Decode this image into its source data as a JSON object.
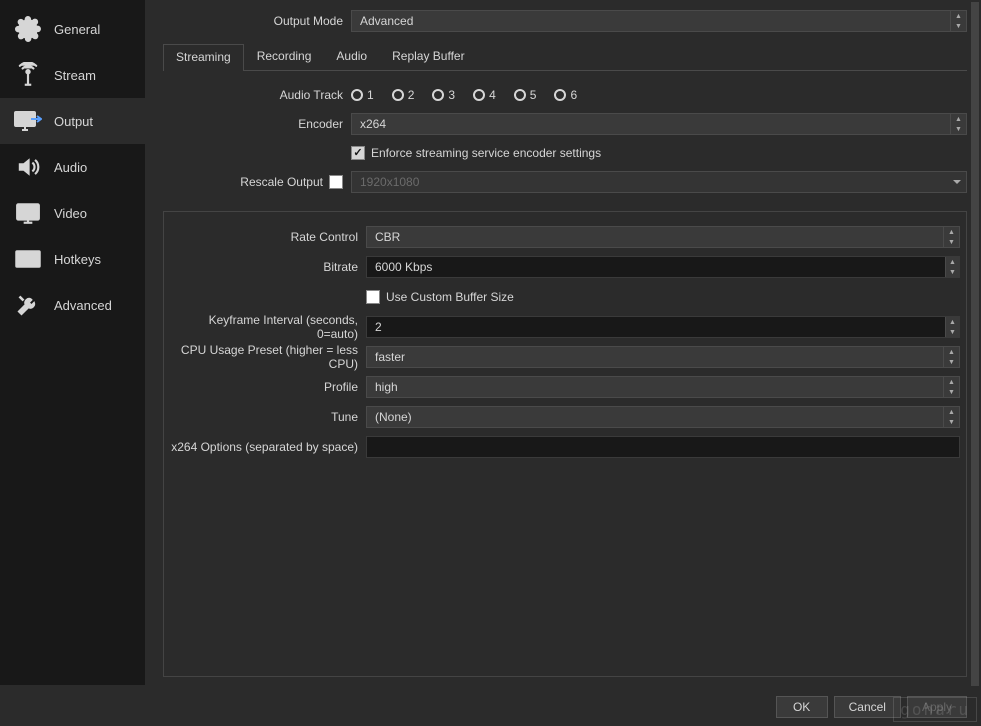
{
  "sidebar": {
    "items": [
      {
        "label": "General"
      },
      {
        "label": "Stream"
      },
      {
        "label": "Output"
      },
      {
        "label": "Audio"
      },
      {
        "label": "Video"
      },
      {
        "label": "Hotkeys"
      },
      {
        "label": "Advanced"
      }
    ],
    "active_index": 2
  },
  "output_mode": {
    "label": "Output Mode",
    "value": "Advanced"
  },
  "tabs": {
    "items": [
      {
        "label": "Streaming"
      },
      {
        "label": "Recording"
      },
      {
        "label": "Audio"
      },
      {
        "label": "Replay Buffer"
      }
    ],
    "active_index": 0
  },
  "streaming": {
    "audio_track": {
      "label": "Audio Track",
      "options": [
        "1",
        "2",
        "3",
        "4",
        "5",
        "6"
      ],
      "selected": "1"
    },
    "encoder": {
      "label": "Encoder",
      "value": "x264"
    },
    "enforce": {
      "label": "Enforce streaming service encoder settings",
      "checked": true
    },
    "rescale": {
      "label": "Rescale Output",
      "checked": false,
      "value": "1920x1080"
    }
  },
  "encoder_settings": {
    "rate_control": {
      "label": "Rate Control",
      "value": "CBR"
    },
    "bitrate": {
      "label": "Bitrate",
      "value": "6000 Kbps"
    },
    "custom_buffer": {
      "label": "Use Custom Buffer Size",
      "checked": false
    },
    "keyframe": {
      "label": "Keyframe Interval (seconds, 0=auto)",
      "value": "2"
    },
    "cpu_preset": {
      "label": "CPU Usage Preset (higher = less CPU)",
      "value": "faster"
    },
    "profile": {
      "label": "Profile",
      "value": "high"
    },
    "tune": {
      "label": "Tune",
      "value": "(None)"
    },
    "x264_opts": {
      "label": "x264 Options (separated by space)",
      "value": ""
    }
  },
  "buttons": {
    "ok": "OK",
    "cancel": "Cancel",
    "apply": "Apply"
  },
  "watermark": "goharu"
}
